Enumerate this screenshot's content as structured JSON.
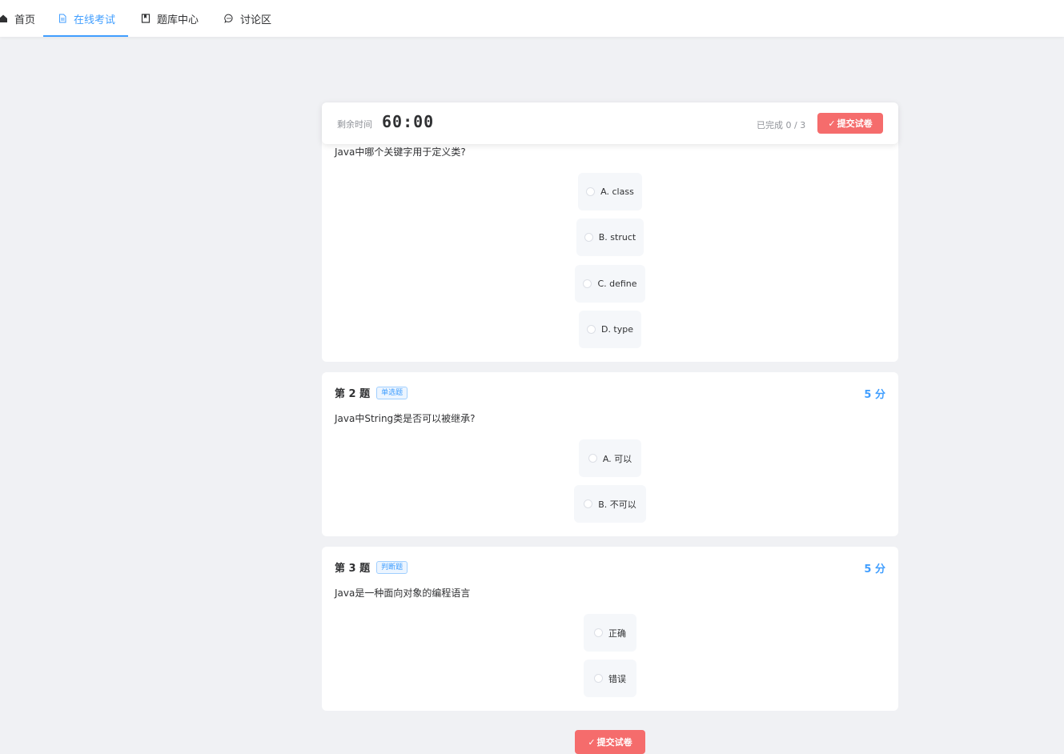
{
  "nav": {
    "items": [
      {
        "label": "首页",
        "icon": "home-icon"
      },
      {
        "label": "在线考试",
        "icon": "document-icon"
      },
      {
        "label": "题库中心",
        "icon": "book-icon"
      },
      {
        "label": "讨论区",
        "icon": "chat-icon"
      }
    ],
    "active_color": "#409eff"
  },
  "exam_header": {
    "timer_label": "剩余时间",
    "timer_value": "60:00",
    "progress": "已完成 0 / 3",
    "submit_label": "提交试卷"
  },
  "questions": [
    {
      "text": "Java中哪个关键字用于定义类?",
      "options": [
        "A. class",
        "B. struct",
        "C. define",
        "D. type"
      ]
    },
    {
      "number": "第 2 题",
      "type": "单选题",
      "score": "5 分",
      "text": "Java中String类是否可以被继承?",
      "options": [
        "A. 可以",
        "B. 不可以"
      ]
    },
    {
      "number": "第 3 题",
      "type": "判断题",
      "score": "5 分",
      "text": "Java是一种面向对象的编程语言",
      "options": [
        "正确",
        "错误"
      ]
    }
  ],
  "bottom_submit_label": "提交试卷",
  "colors": {
    "accent": "#409eff",
    "danger": "#f56c6c",
    "background": "#f0f1f4"
  }
}
